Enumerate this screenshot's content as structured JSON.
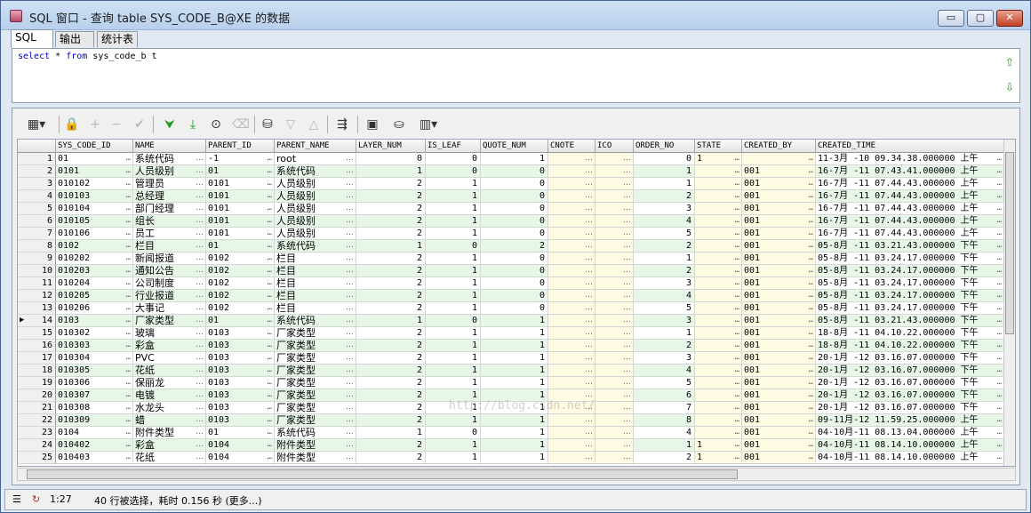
{
  "window": {
    "title": "SQL 窗口 - 查询 table SYS_CODE_B@XE 的数据",
    "controls": {
      "minimize": "▭",
      "maximize": "▢",
      "close": "✕"
    }
  },
  "tabs": [
    "SQL",
    "输出",
    "统计表"
  ],
  "editor": {
    "keyword_select": "select",
    "middle": " * ",
    "keyword_from": "from",
    "tail": " sys_code_b t"
  },
  "toolbar_icons": [
    "grid-select-icon",
    "lock-icon",
    "add-row-icon",
    "delete-row-icon",
    "post-icon",
    "fetch-next-icon",
    "fetch-last-icon",
    "find-icon",
    "clear-icon",
    "query-by-example-icon",
    "sort-desc-icon",
    "sort-asc-icon",
    "single-record-icon",
    "save-icon",
    "export-icon",
    "chart-icon"
  ],
  "grid": {
    "columns": [
      "",
      "SYS_CODE_ID",
      "NAME",
      "PARENT_ID",
      "PARENT_NAME",
      "LAYER_NUM",
      "IS_LEAF",
      "QUOTE_NUM",
      "CNOTE",
      "ICO",
      "ORDER_NO",
      "STATE",
      "CREATED_BY",
      "CREATED_TIME"
    ],
    "rows": [
      [
        "1",
        "01",
        "系统代码",
        "-1",
        "root",
        "0",
        "0",
        "1",
        "",
        "",
        "0",
        "1",
        "",
        "11-3月 -10 09.34.38.000000 上午"
      ],
      [
        "2",
        "0101",
        "人员级别",
        "01",
        "系统代码",
        "1",
        "0",
        "0",
        "",
        "",
        "1",
        "",
        "001",
        "16-7月 -11 07.43.41.000000 上午"
      ],
      [
        "3",
        "010102",
        "管理员",
        "0101",
        "人员级别",
        "2",
        "1",
        "0",
        "",
        "",
        "1",
        "",
        "001",
        "16-7月 -11 07.44.43.000000 上午"
      ],
      [
        "4",
        "010103",
        "总经理",
        "0101",
        "人员级别",
        "2",
        "1",
        "0",
        "",
        "",
        "2",
        "",
        "001",
        "16-7月 -11 07.44.43.000000 上午"
      ],
      [
        "5",
        "010104",
        "部门经理",
        "0101",
        "人员级别",
        "2",
        "1",
        "0",
        "",
        "",
        "3",
        "",
        "001",
        "16-7月 -11 07.44.43.000000 上午"
      ],
      [
        "6",
        "010105",
        "组长",
        "0101",
        "人员级别",
        "2",
        "1",
        "0",
        "",
        "",
        "4",
        "",
        "001",
        "16-7月 -11 07.44.43.000000 上午"
      ],
      [
        "7",
        "010106",
        "员工",
        "0101",
        "人员级别",
        "2",
        "1",
        "0",
        "",
        "",
        "5",
        "",
        "001",
        "16-7月 -11 07.44.43.000000 上午"
      ],
      [
        "8",
        "0102",
        "栏目",
        "01",
        "系统代码",
        "1",
        "0",
        "2",
        "",
        "",
        "2",
        "",
        "001",
        "05-8月 -11 03.21.43.000000 下午"
      ],
      [
        "9",
        "010202",
        "新闻报道",
        "0102",
        "栏目",
        "2",
        "1",
        "0",
        "",
        "",
        "1",
        "",
        "001",
        "05-8月 -11 03.24.17.000000 下午"
      ],
      [
        "10",
        "010203",
        "通知公告",
        "0102",
        "栏目",
        "2",
        "1",
        "0",
        "",
        "",
        "2",
        "",
        "001",
        "05-8月 -11 03.24.17.000000 下午"
      ],
      [
        "11",
        "010204",
        "公司制度",
        "0102",
        "栏目",
        "2",
        "1",
        "0",
        "",
        "",
        "3",
        "",
        "001",
        "05-8月 -11 03.24.17.000000 下午"
      ],
      [
        "12",
        "010205",
        "行业报道",
        "0102",
        "栏目",
        "2",
        "1",
        "0",
        "",
        "",
        "4",
        "",
        "001",
        "05-8月 -11 03.24.17.000000 下午"
      ],
      [
        "13",
        "010206",
        "大事记",
        "0102",
        "栏目",
        "2",
        "1",
        "0",
        "",
        "",
        "5",
        "",
        "001",
        "05-8月 -11 03.24.17.000000 下午"
      ],
      [
        "14",
        "0103",
        "厂家类型",
        "01",
        "系统代码",
        "1",
        "0",
        "1",
        "",
        "",
        "3",
        "",
        "001",
        "05-8月 -11 03.21.43.000000 下午"
      ],
      [
        "15",
        "010302",
        "玻璃",
        "0103",
        "厂家类型",
        "2",
        "1",
        "1",
        "",
        "",
        "1",
        "",
        "001",
        "18-8月 -11 04.10.22.000000 下午"
      ],
      [
        "16",
        "010303",
        "彩盒",
        "0103",
        "厂家类型",
        "2",
        "1",
        "1",
        "",
        "",
        "2",
        "",
        "001",
        "18-8月 -11 04.10.22.000000 下午"
      ],
      [
        "17",
        "010304",
        "PVC",
        "0103",
        "厂家类型",
        "2",
        "1",
        "1",
        "",
        "",
        "3",
        "",
        "001",
        "20-1月 -12 03.16.07.000000 下午"
      ],
      [
        "18",
        "010305",
        "花纸",
        "0103",
        "厂家类型",
        "2",
        "1",
        "1",
        "",
        "",
        "4",
        "",
        "001",
        "20-1月 -12 03.16.07.000000 下午"
      ],
      [
        "19",
        "010306",
        "保丽龙",
        "0103",
        "厂家类型",
        "2",
        "1",
        "1",
        "",
        "",
        "5",
        "",
        "001",
        "20-1月 -12 03.16.07.000000 下午"
      ],
      [
        "20",
        "010307",
        "电镀",
        "0103",
        "厂家类型",
        "2",
        "1",
        "1",
        "",
        "",
        "6",
        "",
        "001",
        "20-1月 -12 03.16.07.000000 下午"
      ],
      [
        "21",
        "010308",
        "水龙头",
        "0103",
        "厂家类型",
        "2",
        "1",
        "1",
        "",
        "",
        "7",
        "",
        "001",
        "20-1月 -12 03.16.07.000000 下午"
      ],
      [
        "22",
        "010309",
        "蜡",
        "0103",
        "厂家类型",
        "2",
        "1",
        "1",
        "",
        "",
        "8",
        "",
        "001",
        "09-11月-12 11.59.25.000000 上午"
      ],
      [
        "23",
        "0104",
        "附件类型",
        "01",
        "系统代码",
        "1",
        "0",
        "1",
        "",
        "",
        "4",
        "",
        "001",
        "04-10月-11 08.13.04.000000 上午"
      ],
      [
        "24",
        "010402",
        "彩盒",
        "0104",
        "附件类型",
        "2",
        "1",
        "1",
        "",
        "",
        "1",
        "1",
        "001",
        "04-10月-11 08.14.10.000000 上午"
      ],
      [
        "25",
        "010403",
        "花纸",
        "0104",
        "附件类型",
        "2",
        "1",
        "1",
        "",
        "",
        "2",
        "1",
        "001",
        "04-10月-11 08.14.10.000000 上午"
      ]
    ],
    "current_row_marker": "▶"
  },
  "watermark": "http://blog.csdn.net/",
  "status": {
    "position": "1:27",
    "message": "40 行被选择，耗时 0.156 秒 (更多...)"
  }
}
